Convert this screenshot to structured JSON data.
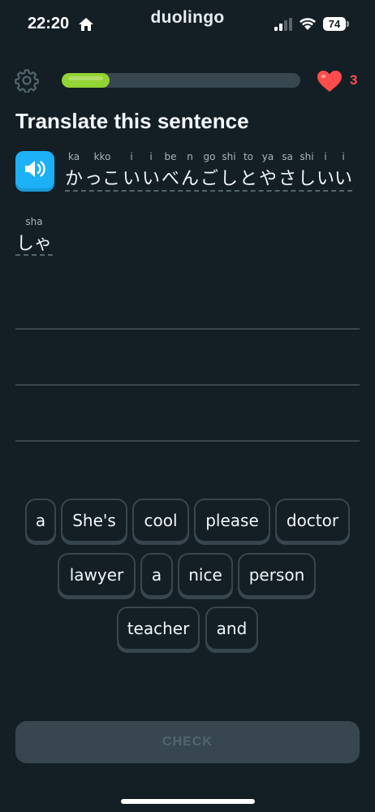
{
  "status_bar": {
    "time": "22:20",
    "brand": "duolingo",
    "battery": "74",
    "icons": [
      "home-icon",
      "signal-icon",
      "wifi-icon",
      "battery-icon"
    ]
  },
  "header": {
    "progress_fraction": 0.2,
    "hearts": "3",
    "colors": {
      "progress": "#93d333",
      "heart": "#ff4b4b",
      "background": "#131f24"
    }
  },
  "prompt": {
    "title": "Translate this sentence",
    "words": [
      {
        "romaji": "ka",
        "kana": "か"
      },
      {
        "romaji": "kko",
        "kana": "っこ"
      },
      {
        "romaji": "i",
        "kana": "い"
      },
      {
        "romaji": "i",
        "kana": "い"
      },
      {
        "romaji": "be",
        "kana": "べ"
      },
      {
        "romaji": "n",
        "kana": "ん"
      },
      {
        "romaji": "go",
        "kana": "ご"
      },
      {
        "romaji": "shi",
        "kana": "し"
      },
      {
        "romaji": "to",
        "kana": "と"
      },
      {
        "romaji": "ya",
        "kana": "や"
      },
      {
        "romaji": "sa",
        "kana": "さ"
      },
      {
        "romaji": "shi",
        "kana": "し"
      },
      {
        "romaji": "i",
        "kana": "い"
      },
      {
        "romaji": "i",
        "kana": "い"
      },
      {
        "romaji": "sha",
        "kana": "しゃ"
      }
    ]
  },
  "word_bank": [
    "a",
    "She's",
    "cool",
    "please",
    "doctor",
    "lawyer",
    "a",
    "nice",
    "person",
    "teacher",
    "and"
  ],
  "check_label": "CHECK"
}
